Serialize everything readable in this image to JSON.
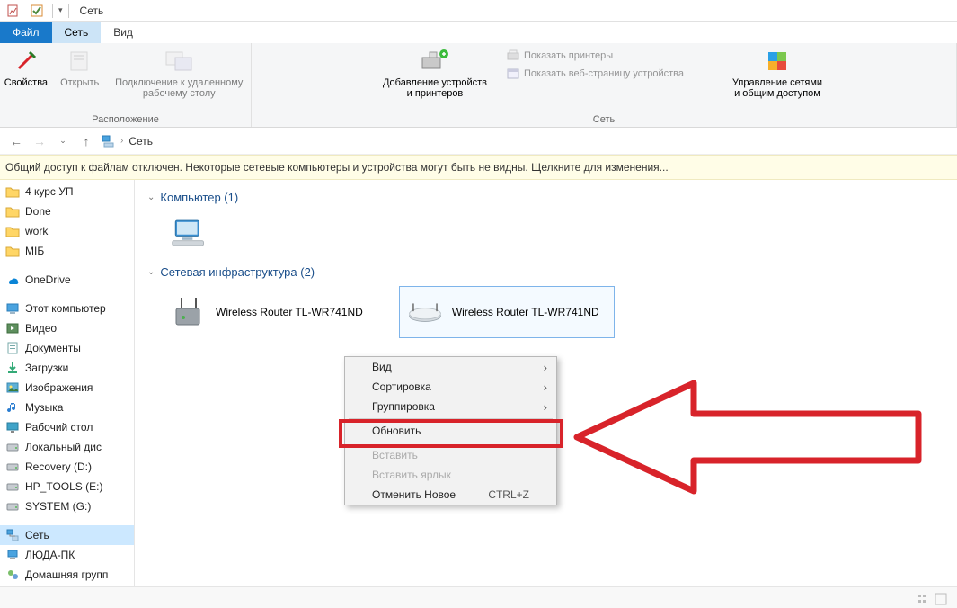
{
  "window": {
    "title": "Сеть"
  },
  "tabs": {
    "file": "Файл",
    "network": "Сеть",
    "view": "Вид"
  },
  "ribbon": {
    "location": {
      "name": "Расположение",
      "properties": "Свойства",
      "open": "Открыть",
      "rdp": "Подключение к удаленному\nрабочему столу"
    },
    "network": {
      "name": "Сеть",
      "add_devices": "Добавление устройств\nи принтеров",
      "show_printers": "Показать принтеры",
      "show_device_page": "Показать веб-страницу устройства",
      "manage": "Управление сетями\nи общим доступом"
    }
  },
  "breadcrumb": {
    "root": "Сеть"
  },
  "notice": "Общий доступ к файлам отключен. Некоторые сетевые компьютеры и устройства могут быть не видны. Щелкните для изменения...",
  "nav_items": [
    {
      "label": "4 курс УП",
      "icon": "folder"
    },
    {
      "label": "Done",
      "icon": "folder"
    },
    {
      "label": "work",
      "icon": "folder"
    },
    {
      "label": "МІБ",
      "icon": "folder"
    },
    {
      "spacer": true
    },
    {
      "label": "OneDrive",
      "icon": "onedrive"
    },
    {
      "spacer": true
    },
    {
      "label": "Этот компьютер",
      "icon": "pc"
    },
    {
      "label": "Видео",
      "icon": "video"
    },
    {
      "label": "Документы",
      "icon": "docs"
    },
    {
      "label": "Загрузки",
      "icon": "downloads"
    },
    {
      "label": "Изображения",
      "icon": "pictures"
    },
    {
      "label": "Музыка",
      "icon": "music"
    },
    {
      "label": "Рабочий стол",
      "icon": "desktop"
    },
    {
      "label": "Локальный дис",
      "icon": "drive"
    },
    {
      "label": "Recovery (D:)",
      "icon": "drive"
    },
    {
      "label": "HP_TOOLS (E:)",
      "icon": "drive"
    },
    {
      "label": "SYSTEM (G:)",
      "icon": "drive"
    },
    {
      "spacer": true
    },
    {
      "label": "Сеть",
      "icon": "network",
      "selected": true
    },
    {
      "label": "ЛЮДА-ПК",
      "icon": "computer"
    },
    {
      "label": "Домашняя групп",
      "icon": "homegroup"
    }
  ],
  "content": {
    "group_computer": {
      "title": "Компьютер (1)"
    },
    "group_infra": {
      "title": "Сетевая инфраструктура (2)",
      "items": [
        {
          "label": "Wireless Router TL-WR741ND"
        },
        {
          "label": "Wireless Router TL-WR741ND",
          "selected": true
        }
      ]
    }
  },
  "context_menu": {
    "view": "Вид",
    "sort": "Сортировка",
    "group": "Группировка",
    "refresh": "Обновить",
    "paste": "Вставить",
    "paste_shortcut": "Вставить ярлык",
    "undo": "Отменить Новое",
    "undo_shortcut": "CTRL+Z"
  }
}
